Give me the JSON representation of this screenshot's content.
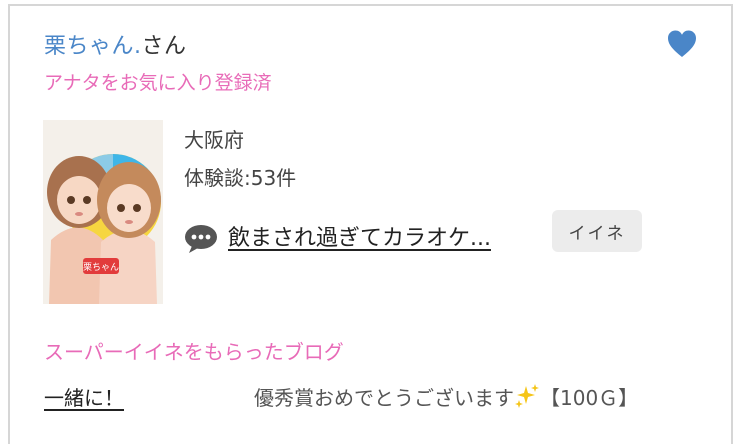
{
  "user": {
    "name": "栗ちゃん.",
    "suffix": "さん",
    "favorite_status": "アナタをお気に入り登録済",
    "region": "大阪府",
    "experience_count": "体験談:53件"
  },
  "post": {
    "title": "飲まされ過ぎてカラオケ...",
    "like_label": "イイネ"
  },
  "super_like": {
    "heading": "スーパーイイネをもらったブログ",
    "blog_title": "一緒に！",
    "award_text": "優秀賞おめでとうございます",
    "award_points": "【100Ｇ】"
  },
  "avatar_badge": "栗ちゃん",
  "colors": {
    "accent_blue": "#4a86c8",
    "accent_pink": "#e86bb8",
    "heart": "#4a86c8"
  },
  "icons": {
    "favorite": "heart-icon",
    "comment": "speech-bubble-icon",
    "sparkle": "sparkles-icon"
  }
}
